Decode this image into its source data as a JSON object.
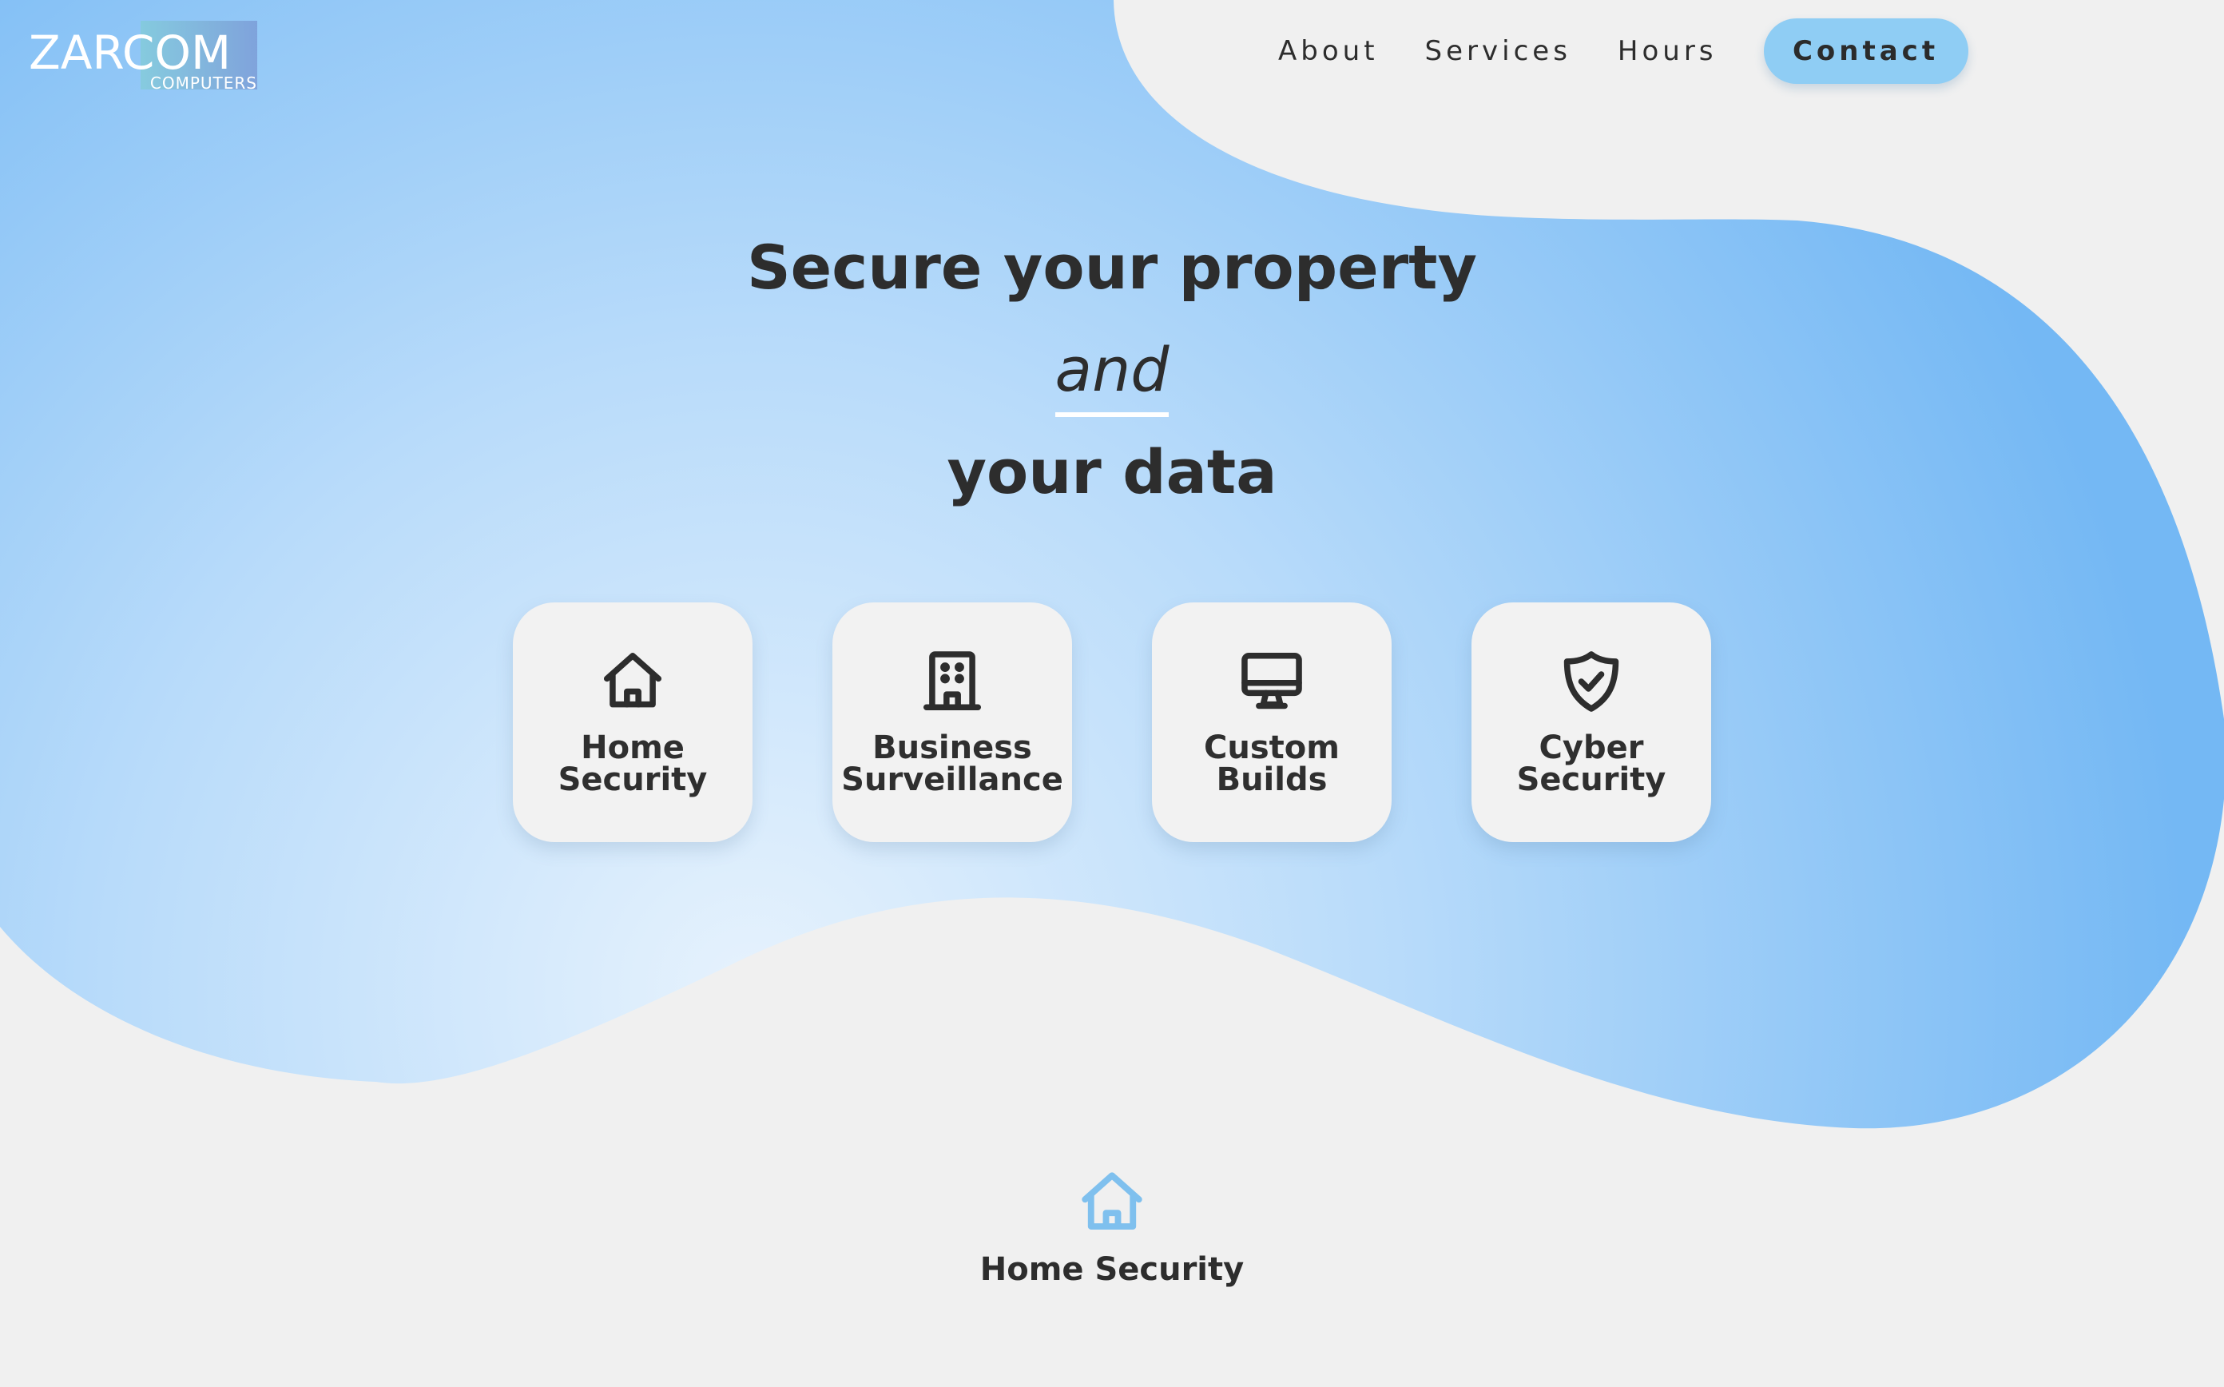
{
  "brand": {
    "name": "ZARCOM",
    "tagline": "COMPUTERS"
  },
  "nav": {
    "links": [
      "About",
      "Services",
      "Hours"
    ],
    "contact_label": "Contact"
  },
  "hero": {
    "line1": "Secure your property",
    "line2": "and",
    "line3": "your data"
  },
  "services": [
    {
      "label_line1": "Home",
      "label_line2": "Security",
      "icon": "home-icon"
    },
    {
      "label_line1": "Business",
      "label_line2": "Surveillance",
      "icon": "building-icon"
    },
    {
      "label_line1": "Custom",
      "label_line2": "Builds",
      "icon": "monitor-icon"
    },
    {
      "label_line1": "Cyber",
      "label_line2": "Security",
      "icon": "shield-check-icon"
    }
  ],
  "section": {
    "icon": "home-icon",
    "title": "Home Security"
  },
  "colors": {
    "page_background": "#f0f0f0",
    "blob_light": "#e4f1fd",
    "blob_dark": "#74b9f3",
    "accent": "#8fcdf4",
    "text": "#2d2d2d",
    "section_icon": "#7fc0ee"
  }
}
